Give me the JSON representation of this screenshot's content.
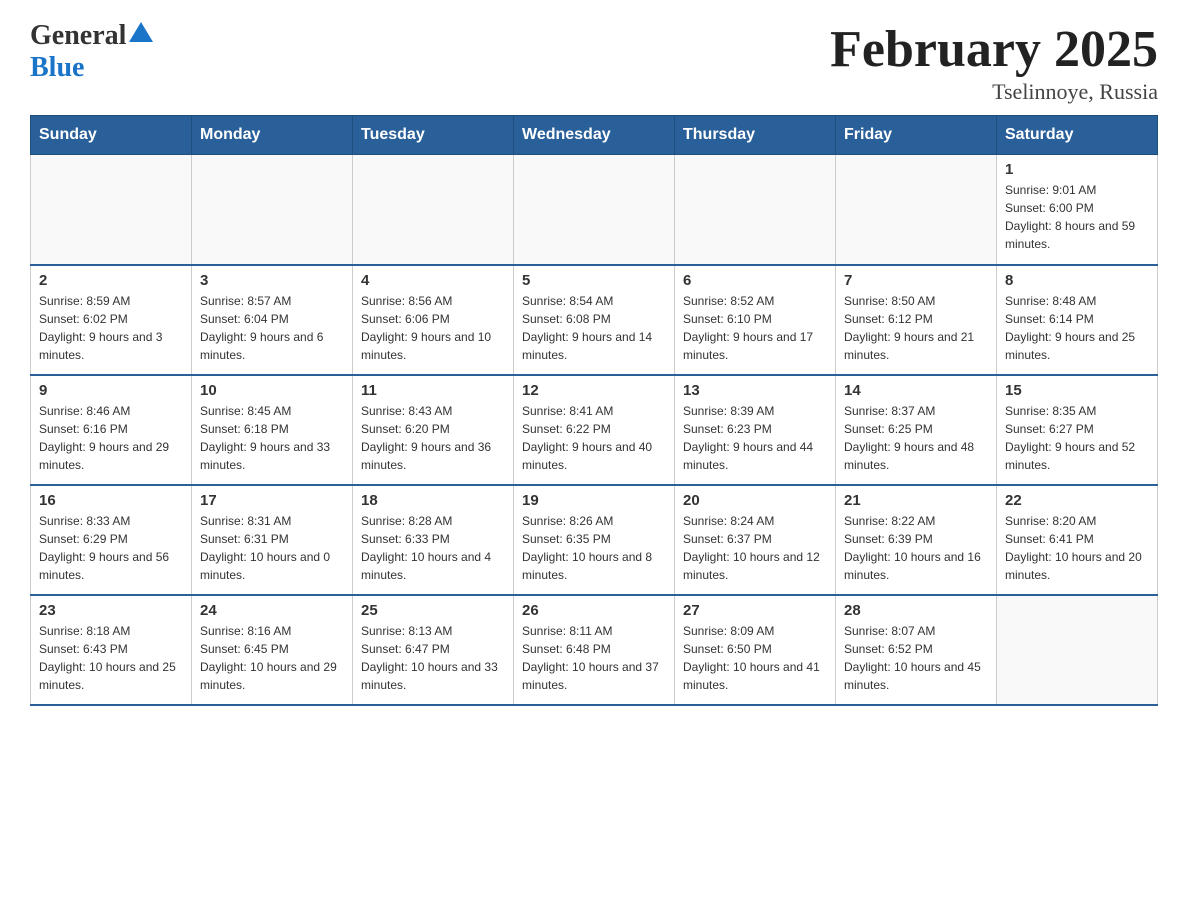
{
  "logo": {
    "general": "General",
    "blue": "Blue"
  },
  "header": {
    "title": "February 2025",
    "subtitle": "Tselinnoye, Russia"
  },
  "days_of_week": [
    "Sunday",
    "Monday",
    "Tuesday",
    "Wednesday",
    "Thursday",
    "Friday",
    "Saturday"
  ],
  "weeks": [
    [
      {
        "day": "",
        "info": ""
      },
      {
        "day": "",
        "info": ""
      },
      {
        "day": "",
        "info": ""
      },
      {
        "day": "",
        "info": ""
      },
      {
        "day": "",
        "info": ""
      },
      {
        "day": "",
        "info": ""
      },
      {
        "day": "1",
        "info": "Sunrise: 9:01 AM\nSunset: 6:00 PM\nDaylight: 8 hours and 59 minutes."
      }
    ],
    [
      {
        "day": "2",
        "info": "Sunrise: 8:59 AM\nSunset: 6:02 PM\nDaylight: 9 hours and 3 minutes."
      },
      {
        "day": "3",
        "info": "Sunrise: 8:57 AM\nSunset: 6:04 PM\nDaylight: 9 hours and 6 minutes."
      },
      {
        "day": "4",
        "info": "Sunrise: 8:56 AM\nSunset: 6:06 PM\nDaylight: 9 hours and 10 minutes."
      },
      {
        "day": "5",
        "info": "Sunrise: 8:54 AM\nSunset: 6:08 PM\nDaylight: 9 hours and 14 minutes."
      },
      {
        "day": "6",
        "info": "Sunrise: 8:52 AM\nSunset: 6:10 PM\nDaylight: 9 hours and 17 minutes."
      },
      {
        "day": "7",
        "info": "Sunrise: 8:50 AM\nSunset: 6:12 PM\nDaylight: 9 hours and 21 minutes."
      },
      {
        "day": "8",
        "info": "Sunrise: 8:48 AM\nSunset: 6:14 PM\nDaylight: 9 hours and 25 minutes."
      }
    ],
    [
      {
        "day": "9",
        "info": "Sunrise: 8:46 AM\nSunset: 6:16 PM\nDaylight: 9 hours and 29 minutes."
      },
      {
        "day": "10",
        "info": "Sunrise: 8:45 AM\nSunset: 6:18 PM\nDaylight: 9 hours and 33 minutes."
      },
      {
        "day": "11",
        "info": "Sunrise: 8:43 AM\nSunset: 6:20 PM\nDaylight: 9 hours and 36 minutes."
      },
      {
        "day": "12",
        "info": "Sunrise: 8:41 AM\nSunset: 6:22 PM\nDaylight: 9 hours and 40 minutes."
      },
      {
        "day": "13",
        "info": "Sunrise: 8:39 AM\nSunset: 6:23 PM\nDaylight: 9 hours and 44 minutes."
      },
      {
        "day": "14",
        "info": "Sunrise: 8:37 AM\nSunset: 6:25 PM\nDaylight: 9 hours and 48 minutes."
      },
      {
        "day": "15",
        "info": "Sunrise: 8:35 AM\nSunset: 6:27 PM\nDaylight: 9 hours and 52 minutes."
      }
    ],
    [
      {
        "day": "16",
        "info": "Sunrise: 8:33 AM\nSunset: 6:29 PM\nDaylight: 9 hours and 56 minutes."
      },
      {
        "day": "17",
        "info": "Sunrise: 8:31 AM\nSunset: 6:31 PM\nDaylight: 10 hours and 0 minutes."
      },
      {
        "day": "18",
        "info": "Sunrise: 8:28 AM\nSunset: 6:33 PM\nDaylight: 10 hours and 4 minutes."
      },
      {
        "day": "19",
        "info": "Sunrise: 8:26 AM\nSunset: 6:35 PM\nDaylight: 10 hours and 8 minutes."
      },
      {
        "day": "20",
        "info": "Sunrise: 8:24 AM\nSunset: 6:37 PM\nDaylight: 10 hours and 12 minutes."
      },
      {
        "day": "21",
        "info": "Sunrise: 8:22 AM\nSunset: 6:39 PM\nDaylight: 10 hours and 16 minutes."
      },
      {
        "day": "22",
        "info": "Sunrise: 8:20 AM\nSunset: 6:41 PM\nDaylight: 10 hours and 20 minutes."
      }
    ],
    [
      {
        "day": "23",
        "info": "Sunrise: 8:18 AM\nSunset: 6:43 PM\nDaylight: 10 hours and 25 minutes."
      },
      {
        "day": "24",
        "info": "Sunrise: 8:16 AM\nSunset: 6:45 PM\nDaylight: 10 hours and 29 minutes."
      },
      {
        "day": "25",
        "info": "Sunrise: 8:13 AM\nSunset: 6:47 PM\nDaylight: 10 hours and 33 minutes."
      },
      {
        "day": "26",
        "info": "Sunrise: 8:11 AM\nSunset: 6:48 PM\nDaylight: 10 hours and 37 minutes."
      },
      {
        "day": "27",
        "info": "Sunrise: 8:09 AM\nSunset: 6:50 PM\nDaylight: 10 hours and 41 minutes."
      },
      {
        "day": "28",
        "info": "Sunrise: 8:07 AM\nSunset: 6:52 PM\nDaylight: 10 hours and 45 minutes."
      },
      {
        "day": "",
        "info": ""
      }
    ]
  ]
}
